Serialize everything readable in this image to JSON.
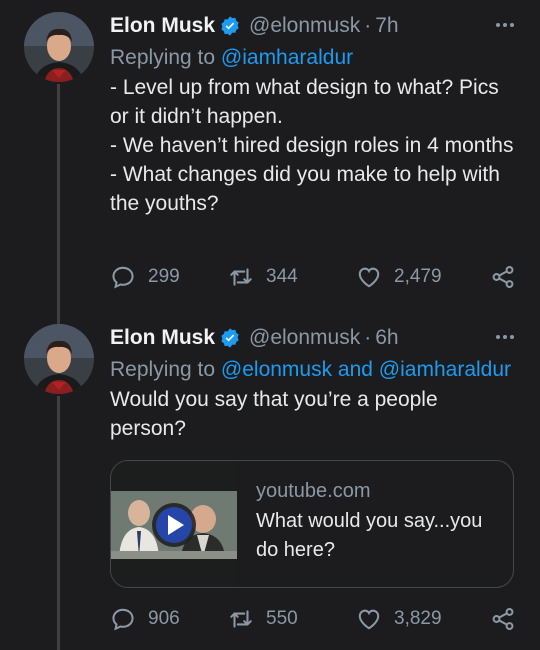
{
  "tweets": [
    {
      "name": "Elon Musk",
      "handle": "@elonmusk",
      "dot": "·",
      "time": "7h",
      "replying_prefix": "Replying to ",
      "replying_to": "@iamharaldur",
      "lines": [
        "- Level up from what design to what? Pics or it didn’t happen.",
        "- We haven’t hired design roles in 4 months",
        "- What changes did you make to help with the youths?"
      ],
      "replies": "299",
      "retweets": "344",
      "likes": "2,479"
    },
    {
      "name": "Elon Musk",
      "handle": "@elonmusk",
      "dot": "·",
      "time": "6h",
      "replying_prefix": "Replying to ",
      "replying_to": "@elonmusk and @iamharaldur",
      "lines": [
        "Would you say that you’re a people person?"
      ],
      "card": {
        "domain": "youtube.com",
        "title": "What would you say...you do here?"
      },
      "replies": "906",
      "retweets": "550",
      "likes": "3,829"
    }
  ],
  "icons": {
    "verified": "verified-badge-icon",
    "more": "more-options-icon",
    "reply": "reply-icon",
    "retweet": "retweet-icon",
    "like": "heart-icon",
    "share": "share-icon",
    "play": "play-icon"
  },
  "colors": {
    "background": "#1c1c1e",
    "accent": "#1d9bf0",
    "muted": "#8b98a5",
    "text": "#e7e9ea"
  }
}
